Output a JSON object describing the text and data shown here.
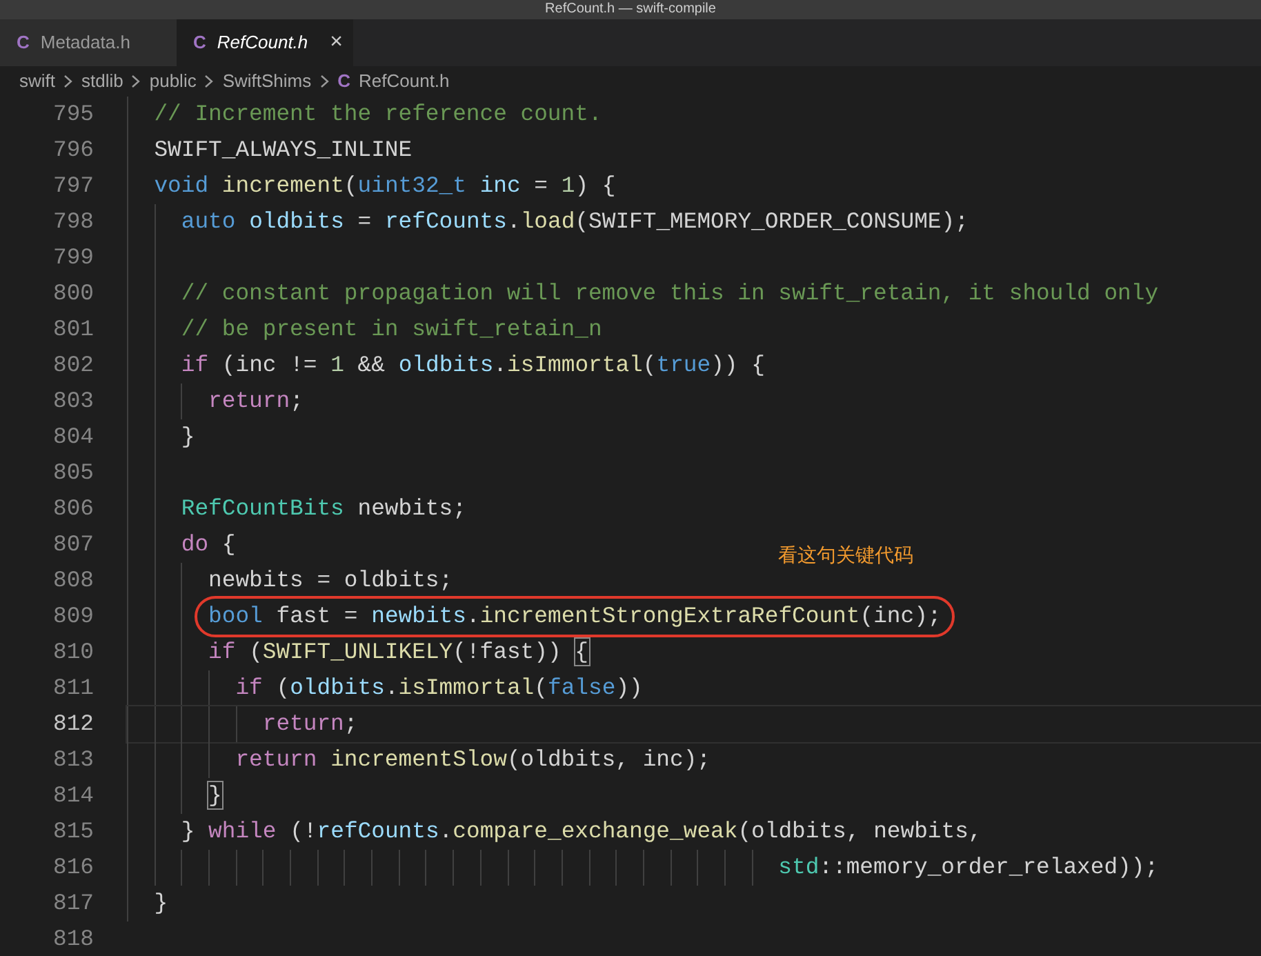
{
  "window": {
    "title": "RefCount.h — swift-compile"
  },
  "tabs": [
    {
      "icon": "C",
      "label": "Metadata.h",
      "selected": false,
      "preview": false
    },
    {
      "icon": "C",
      "label": "RefCount.h",
      "selected": true,
      "preview": true,
      "close": "×"
    }
  ],
  "breadcrumb": [
    {
      "label": "swift"
    },
    {
      "label": "stdlib"
    },
    {
      "label": "public"
    },
    {
      "label": "SwiftShims"
    },
    {
      "label": "RefCount.h",
      "icon": "C"
    }
  ],
  "editor": {
    "lines": [
      {
        "number": "795",
        "selected": false,
        "tokens": [
          {
            "kind": "comment",
            "text": "  // Increment the reference count."
          }
        ]
      },
      {
        "number": "796",
        "selected": false,
        "tokens": [
          {
            "kind": "plain",
            "text": "  SWIFT_ALWAYS_INLINE"
          }
        ]
      },
      {
        "number": "797",
        "selected": false,
        "tokens": [
          {
            "kind": "type",
            "text": "  void"
          },
          {
            "kind": "function",
            "text": " increment"
          },
          {
            "kind": "plain",
            "text": "("
          },
          {
            "kind": "type",
            "text": "uint32_t"
          },
          {
            "kind": "variable",
            "text": " inc"
          },
          {
            "kind": "plain",
            "text": " ="
          },
          {
            "kind": "number",
            "text": " 1"
          },
          {
            "kind": "plain",
            "text": ") {"
          }
        ]
      },
      {
        "number": "798",
        "selected": false,
        "tokens": [
          {
            "kind": "type",
            "text": "    auto"
          },
          {
            "kind": "variable",
            "text": " oldbits"
          },
          {
            "kind": "plain",
            "text": " ="
          },
          {
            "kind": "variable",
            "text": " refCounts"
          },
          {
            "kind": "plain",
            "text": "."
          },
          {
            "kind": "function",
            "text": "load"
          },
          {
            "kind": "plain",
            "text": "(SWIFT_MEMORY_ORDER_CONSUME);"
          }
        ]
      },
      {
        "number": "799",
        "selected": false
      },
      {
        "number": "800",
        "selected": false,
        "tokens": [
          {
            "kind": "comment",
            "text": "    // constant propagation will remove this in swift_retain, it should only"
          }
        ]
      },
      {
        "number": "801",
        "selected": false,
        "tokens": [
          {
            "kind": "comment",
            "text": "    // be present in swift_retain_n"
          }
        ]
      },
      {
        "number": "802",
        "selected": false,
        "tokens": [
          {
            "kind": "control",
            "text": "    if"
          },
          {
            "kind": "plain",
            "text": " (inc !="
          },
          {
            "kind": "number",
            "text": " 1"
          },
          {
            "kind": "plain",
            "text": " &&"
          },
          {
            "kind": "variable",
            "text": " oldbits"
          },
          {
            "kind": "plain",
            "text": "."
          },
          {
            "kind": "function",
            "text": "isImmortal"
          },
          {
            "kind": "plain",
            "text": "("
          },
          {
            "kind": "type",
            "text": "true"
          },
          {
            "kind": "plain",
            "text": ")) {"
          }
        ]
      },
      {
        "number": "803",
        "selected": false,
        "tokens": [
          {
            "kind": "control",
            "text": "      return"
          },
          {
            "kind": "plain",
            "text": ";"
          }
        ]
      },
      {
        "number": "804",
        "selected": false,
        "tokens": [
          {
            "kind": "plain",
            "text": "    }"
          }
        ]
      },
      {
        "number": "805",
        "selected": false
      },
      {
        "number": "806",
        "selected": false,
        "tokens": [
          {
            "kind": "class",
            "text": "    RefCountBits"
          },
          {
            "kind": "plain",
            "text": " newbits;"
          }
        ]
      },
      {
        "number": "807",
        "selected": false,
        "tokens": [
          {
            "kind": "control",
            "text": "    do"
          },
          {
            "kind": "plain",
            "text": " {"
          }
        ]
      },
      {
        "number": "808",
        "selected": false,
        "note": "看这句关键代码",
        "tokens": [
          {
            "kind": "plain",
            "text": "      newbits = oldbits;"
          }
        ]
      },
      {
        "number": "809",
        "selected": false,
        "circled": true,
        "tokens": [
          {
            "kind": "type",
            "text": "      bool"
          },
          {
            "kind": "plain",
            "text": " fast ="
          },
          {
            "kind": "variable",
            "text": " newbits"
          },
          {
            "kind": "plain",
            "text": "."
          },
          {
            "kind": "function",
            "text": "incrementStrongExtraRefCount"
          },
          {
            "kind": "plain",
            "text": "(inc);"
          }
        ]
      },
      {
        "number": "810",
        "selected": false,
        "tokens": [
          {
            "kind": "control",
            "text": "      if"
          },
          {
            "kind": "plain",
            "text": " ("
          },
          {
            "kind": "function",
            "text": "SWIFT_UNLIKELY"
          },
          {
            "kind": "plain",
            "text": "(!fast))"
          },
          {
            "kind": "bracket",
            "text": " {"
          }
        ]
      },
      {
        "number": "811",
        "selected": false,
        "tokens": [
          {
            "kind": "control",
            "text": "        if"
          },
          {
            "kind": "plain",
            "text": " ("
          },
          {
            "kind": "variable",
            "text": "oldbits"
          },
          {
            "kind": "plain",
            "text": "."
          },
          {
            "kind": "function",
            "text": "isImmortal"
          },
          {
            "kind": "plain",
            "text": "("
          },
          {
            "kind": "type",
            "text": "false"
          },
          {
            "kind": "plain",
            "text": "))"
          }
        ]
      },
      {
        "number": "812",
        "selected": true,
        "tokens": [
          {
            "kind": "control",
            "text": "          return"
          },
          {
            "kind": "plain",
            "text": ";"
          }
        ]
      },
      {
        "number": "813",
        "selected": false,
        "tokens": [
          {
            "kind": "control",
            "text": "        return"
          },
          {
            "kind": "function",
            "text": " incrementSlow"
          },
          {
            "kind": "plain",
            "text": "(oldbits, inc);"
          }
        ]
      },
      {
        "number": "814",
        "selected": false,
        "tokens": [
          {
            "kind": "bracket",
            "text": "      }"
          }
        ]
      },
      {
        "number": "815",
        "selected": false,
        "tokens": [
          {
            "kind": "plain",
            "text": "    }"
          },
          {
            "kind": "control",
            "text": " while"
          },
          {
            "kind": "plain",
            "text": " (!"
          },
          {
            "kind": "variable",
            "text": "refCounts"
          },
          {
            "kind": "plain",
            "text": "."
          },
          {
            "kind": "function",
            "text": "compare_exchange_weak"
          },
          {
            "kind": "plain",
            "text": "(oldbits, newbits,"
          }
        ]
      },
      {
        "number": "816",
        "selected": false,
        "tokens": [
          {
            "kind": "class",
            "text": "                                                std"
          },
          {
            "kind": "plain",
            "text": "::memory_order_relaxed));"
          }
        ]
      },
      {
        "number": "817",
        "selected": false,
        "tokens": [
          {
            "kind": "plain",
            "text": "  }"
          }
        ]
      },
      {
        "number": "818",
        "selected": false
      }
    ]
  }
}
